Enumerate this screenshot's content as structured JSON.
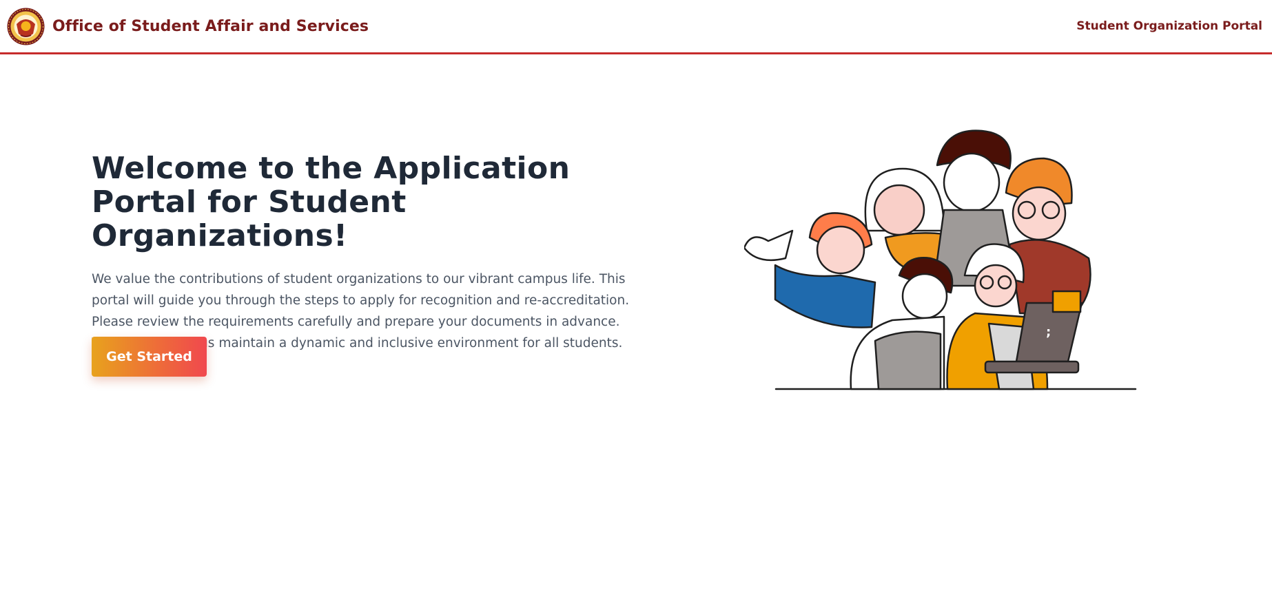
{
  "header": {
    "site_title": "Office of Student Affair and Services",
    "nav_link": "Student Organization Portal",
    "logo_icon": "university-seal-logo"
  },
  "hero": {
    "title": "Welcome to the Application Portal for Student Organizations!",
    "description": "We value the contributions of student organizations to our vibrant campus life. This portal will guide you through the steps to apply for recognition and re-accreditation. Please review the requirements carefully and prepare your documents in advance. Your efforts help us maintain a dynamic and inclusive environment for all students.",
    "cta_label": "Get Started"
  },
  "illustration": {
    "icon": "students-group-illustration",
    "laptop_glyph": ";"
  },
  "colors": {
    "brand": "#7a1c1c",
    "header_border": "#c62b2b",
    "heading": "#1f2937",
    "body_text": "#4b5563",
    "cta_gradient_start": "#e8a21d",
    "cta_gradient_end": "#f0484e"
  }
}
